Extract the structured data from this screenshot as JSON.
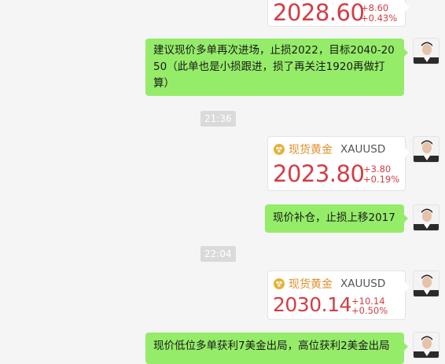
{
  "messages": [
    {
      "type": "quote",
      "price": "2028.60",
      "change_abs": "+8.60",
      "change_pct": "+0.43%"
    },
    {
      "type": "text",
      "lines": [
        "建议现价多单再次进场，止损2022，目标2040-20",
        "50（此单也是小损跟进，损了再关注1920再做打",
        "算）"
      ]
    },
    {
      "type": "time",
      "text": "21:36"
    },
    {
      "type": "quote",
      "name": "现货黄金",
      "symbol": "XAUUSD",
      "price": "2023.80",
      "change_abs": "+3.80",
      "change_pct": "+0.19%"
    },
    {
      "type": "text",
      "lines": [
        "现价补仓，止损上移2017"
      ]
    },
    {
      "type": "time",
      "text": "22:04"
    },
    {
      "type": "quote",
      "name": "现货黄金",
      "symbol": "XAUUSD",
      "price": "2030.14",
      "change_abs": "+10.14",
      "change_pct": "+0.50%"
    },
    {
      "type": "text",
      "lines": [
        "现价低位多单获利7美金出局，高位获利2美金出局"
      ]
    }
  ],
  "colors": {
    "bubble": "#95ec69",
    "price": "#d33d45",
    "quote_name": "#e0902b",
    "background": "#f5f5f5"
  },
  "icons": {
    "avatar": "avatar",
    "coin": "gold-coin-icon"
  }
}
